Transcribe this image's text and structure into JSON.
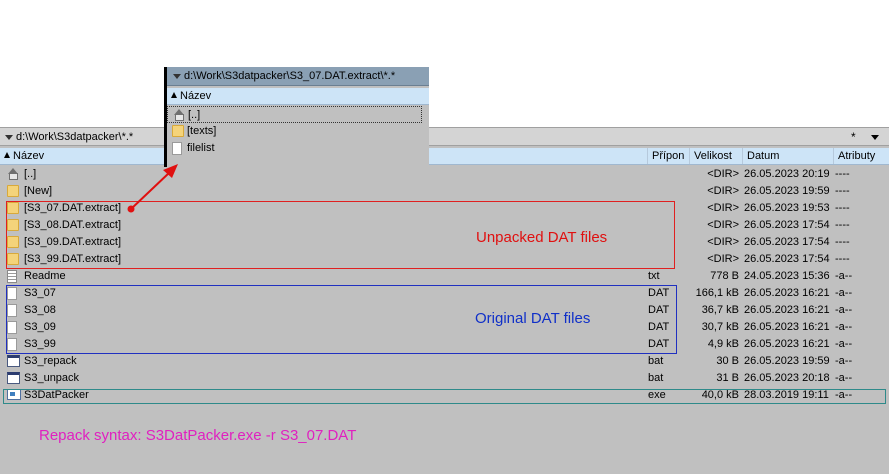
{
  "main_panel": {
    "path": "d:\\Work\\S3datpacker\\*.*",
    "star": "*",
    "columns": {
      "name": "Název",
      "ext": "Přípon",
      "size": "Velikost",
      "date": "Datum",
      "attr": "Atributy"
    },
    "rows": [
      {
        "name": "[..]",
        "ext": "",
        "size": "<DIR>",
        "date": "26.05.2023 20:19",
        "attr": "----",
        "icon": "parent-dir-icon"
      },
      {
        "name": "[New]",
        "ext": "",
        "size": "<DIR>",
        "date": "26.05.2023 19:59",
        "attr": "----",
        "icon": "folder-icon"
      },
      {
        "name": "[S3_07.DAT.extract]",
        "ext": "",
        "size": "<DIR>",
        "date": "26.05.2023 19:53",
        "attr": "----",
        "icon": "folder-icon"
      },
      {
        "name": "[S3_08.DAT.extract]",
        "ext": "",
        "size": "<DIR>",
        "date": "26.05.2023 17:54",
        "attr": "----",
        "icon": "folder-icon"
      },
      {
        "name": "[S3_09.DAT.extract]",
        "ext": "",
        "size": "<DIR>",
        "date": "26.05.2023 17:54",
        "attr": "----",
        "icon": "folder-icon"
      },
      {
        "name": "[S3_99.DAT.extract]",
        "ext": "",
        "size": "<DIR>",
        "date": "26.05.2023 17:54",
        "attr": "----",
        "icon": "folder-icon"
      },
      {
        "name": "Readme",
        "ext": "txt",
        "size": "778 B",
        "date": "24.05.2023 15:36",
        "attr": "-a--",
        "icon": "text-file-icon"
      },
      {
        "name": "S3_07",
        "ext": "DAT",
        "size": "166,1 kB",
        "date": "26.05.2023 16:21",
        "attr": "-a--",
        "icon": "file-icon"
      },
      {
        "name": "S3_08",
        "ext": "DAT",
        "size": "36,7 kB",
        "date": "26.05.2023 16:21",
        "attr": "-a--",
        "icon": "file-icon"
      },
      {
        "name": "S3_09",
        "ext": "DAT",
        "size": "30,7 kB",
        "date": "26.05.2023 16:21",
        "attr": "-a--",
        "icon": "file-icon"
      },
      {
        "name": "S3_99",
        "ext": "DAT",
        "size": "4,9 kB",
        "date": "26.05.2023 16:21",
        "attr": "-a--",
        "icon": "file-icon"
      },
      {
        "name": "S3_repack",
        "ext": "bat",
        "size": "30 B",
        "date": "26.05.2023 19:59",
        "attr": "-a--",
        "icon": "batch-file-icon"
      },
      {
        "name": "S3_unpack",
        "ext": "bat",
        "size": "31 B",
        "date": "26.05.2023 20:18",
        "attr": "-a--",
        "icon": "batch-file-icon"
      },
      {
        "name": "S3DatPacker",
        "ext": "exe",
        "size": "40,0 kB",
        "date": "28.03.2019 19:11",
        "attr": "-a--",
        "icon": "executable-icon"
      }
    ]
  },
  "sub_panel": {
    "path": "d:\\Work\\S3datpacker\\S3_07.DAT.extract\\*.*",
    "column_name": "Název",
    "rows": [
      {
        "name": "[..]",
        "icon": "parent-dir-icon"
      },
      {
        "name": "[texts]",
        "icon": "folder-icon"
      },
      {
        "name": "filelist",
        "icon": "file-icon"
      }
    ]
  },
  "annotations": {
    "unpacked": "Unpacked DAT files",
    "original": "Original DAT files",
    "repack_syntax": "Repack syntax: S3DatPacker.exe -r S3_07.DAT",
    "colors": {
      "red": "#e01010",
      "blue": "#1030c8",
      "magenta": "#e020c0",
      "teal": "#2e8a8a"
    }
  }
}
